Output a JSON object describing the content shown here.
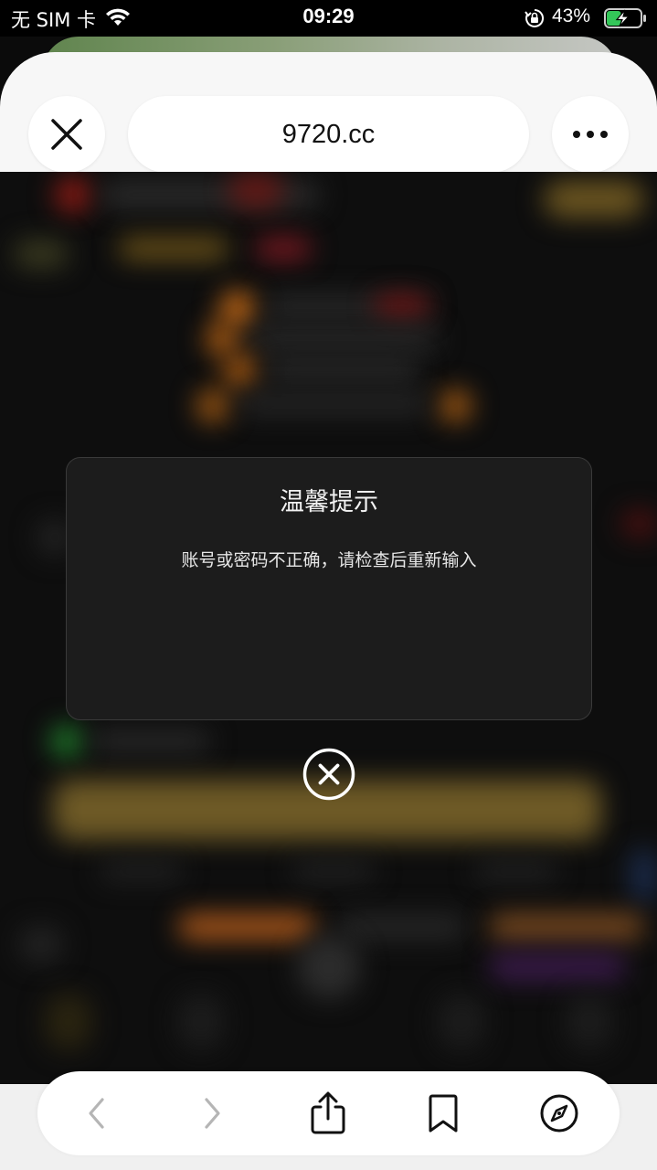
{
  "status_bar": {
    "carrier": "无 SIM 卡",
    "time": "09:29",
    "battery_percent": "43%",
    "battery_level": 0.43,
    "icons": [
      "wifi-icon",
      "orientation-lock-icon",
      "battery-charging-icon"
    ]
  },
  "browser": {
    "url": "9720.cc",
    "close_icon": "close-icon",
    "more_icon": "more-dots-icon"
  },
  "dialog": {
    "title": "温馨提示",
    "message": "账号或密码不正确，请检查后重新输入",
    "close_icon": "circle-close-icon"
  },
  "toolbar": {
    "buttons": [
      "back-icon",
      "forward-icon",
      "share-icon",
      "bookmarks-icon",
      "compass-icon"
    ]
  },
  "colors": {
    "accent_blur_gold": "#b08a2a",
    "accent_blur_orange": "#e07a1a",
    "accent_blur_red": "#c0302a",
    "accent_blur_green": "#2fb34a"
  }
}
